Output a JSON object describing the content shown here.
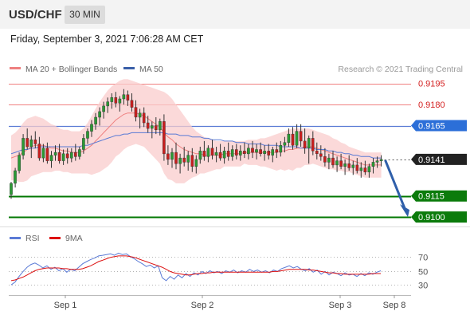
{
  "header": {
    "symbol": "USD/CHF",
    "timeframe": "30 MIN"
  },
  "timestamp": "Friday, September 3, 2021 7:06:28 AM CET",
  "legend": {
    "ma20_label": "MA 20 + Bollinger Bands",
    "ma50_label": "MA 50",
    "copyright": "Research © 2021 Trading Central"
  },
  "colors": {
    "bull": "#2a9a34",
    "bear": "#c81e1e",
    "ma20": "#ee8080",
    "ma50": "#5a7bd5",
    "band": "#f9cccc",
    "support": "#007700",
    "resistance": "#f08080",
    "current": "#222222",
    "arrow": "#2f5faa",
    "rsi": "#5b7bd6",
    "rsi_ma": "#dd1111"
  },
  "chart_data": [
    {
      "type": "candlestick",
      "ylim": [
        0.9095,
        0.9205
      ],
      "x_ticks": [
        "Sep 1",
        "Sep 2",
        "Sep 3",
        "Sep 8"
      ],
      "levels": [
        {
          "label": "0.9195",
          "value": 0.9195,
          "kind": "resistance"
        },
        {
          "label": "0.9180",
          "value": 0.918,
          "kind": "resistance"
        },
        {
          "label": "0.9165",
          "value": 0.9165,
          "kind": "pivot"
        },
        {
          "label": "0.9141",
          "value": 0.9141,
          "kind": "current"
        },
        {
          "label": "0.9115",
          "value": 0.9115,
          "kind": "support"
        },
        {
          "label": "0.9100",
          "value": 0.91,
          "kind": "support"
        }
      ],
      "forecast_arrow": {
        "from": 0.9141,
        "to": 0.91
      },
      "candles": [
        [
          0.9116,
          0.9125,
          0.9113,
          0.9124
        ],
        [
          0.9124,
          0.9135,
          0.9121,
          0.9133
        ],
        [
          0.9133,
          0.9146,
          0.9131,
          0.9144
        ],
        [
          0.9144,
          0.9159,
          0.9141,
          0.9156
        ],
        [
          0.9156,
          0.9163,
          0.9148,
          0.915
        ],
        [
          0.915,
          0.9158,
          0.9142,
          0.9155
        ],
        [
          0.9155,
          0.9161,
          0.9149,
          0.9152
        ],
        [
          0.9152,
          0.9157,
          0.914,
          0.9142
        ],
        [
          0.9142,
          0.9152,
          0.9139,
          0.9149
        ],
        [
          0.9149,
          0.9153,
          0.9138,
          0.914
        ],
        [
          0.914,
          0.9147,
          0.9135,
          0.9144
        ],
        [
          0.9144,
          0.9151,
          0.914,
          0.9146
        ],
        [
          0.9146,
          0.9152,
          0.9138,
          0.914
        ],
        [
          0.914,
          0.9148,
          0.9137,
          0.9145
        ],
        [
          0.9145,
          0.9149,
          0.9138,
          0.9142
        ],
        [
          0.9142,
          0.9149,
          0.9139,
          0.9146
        ],
        [
          0.9146,
          0.9152,
          0.914,
          0.9143
        ],
        [
          0.9143,
          0.915,
          0.9141,
          0.9148
        ],
        [
          0.9148,
          0.9159,
          0.9145,
          0.9156
        ],
        [
          0.9156,
          0.9163,
          0.9152,
          0.9161
        ],
        [
          0.9161,
          0.9169,
          0.9157,
          0.9166
        ],
        [
          0.9166,
          0.9174,
          0.9162,
          0.9171
        ],
        [
          0.9171,
          0.9178,
          0.9165,
          0.9175
        ],
        [
          0.9175,
          0.9182,
          0.917,
          0.9179
        ],
        [
          0.9179,
          0.9185,
          0.9174,
          0.9182
        ],
        [
          0.9182,
          0.9188,
          0.9177,
          0.9185
        ],
        [
          0.9185,
          0.9189,
          0.9178,
          0.9181
        ],
        [
          0.9181,
          0.9186,
          0.9175,
          0.9184
        ],
        [
          0.9184,
          0.9191,
          0.918,
          0.9187
        ],
        [
          0.9187,
          0.919,
          0.9179,
          0.9183
        ],
        [
          0.9183,
          0.9188,
          0.9175,
          0.9178
        ],
        [
          0.9178,
          0.9183,
          0.9168,
          0.9171
        ],
        [
          0.9171,
          0.9177,
          0.9163,
          0.9174
        ],
        [
          0.9174,
          0.9178,
          0.9164,
          0.9167
        ],
        [
          0.9167,
          0.9172,
          0.916,
          0.9163
        ],
        [
          0.9163,
          0.9168,
          0.9156,
          0.9165
        ],
        [
          0.9165,
          0.9171,
          0.9159,
          0.9162
        ],
        [
          0.9162,
          0.917,
          0.9158,
          0.9168
        ],
        [
          0.9168,
          0.9173,
          0.914,
          0.9145
        ],
        [
          0.9145,
          0.9151,
          0.9137,
          0.9141
        ],
        [
          0.9141,
          0.9149,
          0.9135,
          0.9146
        ],
        [
          0.9146,
          0.9153,
          0.9134,
          0.9138
        ],
        [
          0.9138,
          0.9145,
          0.9131,
          0.9142
        ],
        [
          0.9142,
          0.915,
          0.9136,
          0.9139
        ],
        [
          0.9139,
          0.9147,
          0.9133,
          0.9144
        ],
        [
          0.9144,
          0.9149,
          0.9132,
          0.9136
        ],
        [
          0.9136,
          0.9144,
          0.9131,
          0.9141
        ],
        [
          0.9141,
          0.915,
          0.9138,
          0.9147
        ],
        [
          0.9147,
          0.9154,
          0.914,
          0.9143
        ],
        [
          0.9143,
          0.9151,
          0.9139,
          0.9149
        ],
        [
          0.9149,
          0.9155,
          0.9141,
          0.9144
        ],
        [
          0.9144,
          0.915,
          0.9139,
          0.9146
        ],
        [
          0.9146,
          0.9152,
          0.914,
          0.9142
        ],
        [
          0.9142,
          0.915,
          0.9138,
          0.9147
        ],
        [
          0.9147,
          0.9153,
          0.914,
          0.9143
        ],
        [
          0.9143,
          0.9151,
          0.914,
          0.9148
        ],
        [
          0.9148,
          0.9152,
          0.9141,
          0.9144
        ],
        [
          0.9144,
          0.9151,
          0.914,
          0.9147
        ],
        [
          0.9147,
          0.9153,
          0.9142,
          0.9145
        ],
        [
          0.9145,
          0.9152,
          0.9141,
          0.9149
        ],
        [
          0.9149,
          0.9154,
          0.9142,
          0.9146
        ],
        [
          0.9146,
          0.9152,
          0.9141,
          0.9148
        ],
        [
          0.9148,
          0.9153,
          0.9143,
          0.9145
        ],
        [
          0.9145,
          0.9151,
          0.914,
          0.9147
        ],
        [
          0.9147,
          0.9152,
          0.9141,
          0.9144
        ],
        [
          0.9144,
          0.915,
          0.9139,
          0.9148
        ],
        [
          0.9148,
          0.9153,
          0.9142,
          0.9146
        ],
        [
          0.9146,
          0.9154,
          0.9143,
          0.9151
        ],
        [
          0.9151,
          0.9157,
          0.9146,
          0.9153
        ],
        [
          0.9153,
          0.9163,
          0.915,
          0.9159
        ],
        [
          0.9159,
          0.9164,
          0.9148,
          0.9151
        ],
        [
          0.9151,
          0.9166,
          0.9149,
          0.9161
        ],
        [
          0.9161,
          0.9166,
          0.915,
          0.9154
        ],
        [
          0.9154,
          0.9163,
          0.9145,
          0.9149
        ],
        [
          0.9149,
          0.9158,
          0.9138,
          0.9156
        ],
        [
          0.9156,
          0.9161,
          0.9144,
          0.9147
        ],
        [
          0.9147,
          0.9153,
          0.9141,
          0.9145
        ],
        [
          0.9145,
          0.9151,
          0.914,
          0.9143
        ],
        [
          0.9143,
          0.9149,
          0.9136,
          0.9139
        ],
        [
          0.9139,
          0.9145,
          0.9134,
          0.9142
        ],
        [
          0.9142,
          0.9147,
          0.9135,
          0.9137
        ],
        [
          0.9137,
          0.9143,
          0.9132,
          0.914
        ],
        [
          0.914,
          0.9145,
          0.9134,
          0.9136
        ],
        [
          0.9136,
          0.9141,
          0.913,
          0.9138
        ],
        [
          0.9138,
          0.9144,
          0.9133,
          0.9135
        ],
        [
          0.9135,
          0.914,
          0.913,
          0.9137
        ],
        [
          0.9137,
          0.9142,
          0.9131,
          0.9133
        ],
        [
          0.9133,
          0.9139,
          0.9128,
          0.9135
        ],
        [
          0.9135,
          0.914,
          0.913,
          0.9132
        ],
        [
          0.9132,
          0.9138,
          0.9128,
          0.9136
        ],
        [
          0.9136,
          0.9142,
          0.9131,
          0.9139
        ],
        [
          0.9139,
          0.9143,
          0.9135,
          0.914
        ],
        [
          0.914,
          0.9144,
          0.9136,
          0.9141
        ]
      ],
      "ma20": [
        0.9142,
        0.9143,
        0.9144,
        0.9146,
        0.9148,
        0.915,
        0.9151,
        0.9151,
        0.9151,
        0.915,
        0.9149,
        0.9149,
        0.9148,
        0.9147,
        0.9147,
        0.9146,
        0.9146,
        0.9146,
        0.9147,
        0.9149,
        0.9151,
        0.9154,
        0.9157,
        0.916,
        0.9163,
        0.9166,
        0.9169,
        0.9171,
        0.9173,
        0.9174,
        0.9174,
        0.9174,
        0.9173,
        0.9172,
        0.917,
        0.9168,
        0.9166,
        0.9164,
        0.916,
        0.9157,
        0.9155,
        0.9152,
        0.915,
        0.9148,
        0.9147,
        0.9146,
        0.9145,
        0.9145,
        0.9144,
        0.9144,
        0.9144,
        0.9144,
        0.9144,
        0.9145,
        0.9145,
        0.9145,
        0.9145,
        0.9145,
        0.9146,
        0.9146,
        0.9146,
        0.9146,
        0.9146,
        0.9146,
        0.9146,
        0.9146,
        0.9146,
        0.9147,
        0.9147,
        0.9148,
        0.9148,
        0.9149,
        0.9149,
        0.915,
        0.915,
        0.915,
        0.9149,
        0.9148,
        0.9147,
        0.9146,
        0.9145,
        0.9144,
        0.9143,
        0.9142,
        0.9141,
        0.914,
        0.9139,
        0.9138,
        0.9137,
        0.9137,
        0.9137,
        0.9137,
        0.9137
      ],
      "ma50": [
        0.9145,
        0.9146,
        0.9147,
        0.9148,
        0.9148,
        0.9149,
        0.9149,
        0.915,
        0.915,
        0.915,
        0.915,
        0.915,
        0.915,
        0.915,
        0.915,
        0.915,
        0.915,
        0.915,
        0.9151,
        0.9151,
        0.9152,
        0.9153,
        0.9154,
        0.9155,
        0.9156,
        0.9157,
        0.9158,
        0.9158,
        0.9159,
        0.9159,
        0.916,
        0.916,
        0.916,
        0.916,
        0.916,
        0.916,
        0.916,
        0.916,
        0.916,
        0.9159,
        0.9159,
        0.9159,
        0.9158,
        0.9158,
        0.9158,
        0.9157,
        0.9157,
        0.9157,
        0.9156,
        0.9156,
        0.9155,
        0.9155,
        0.9155,
        0.9154,
        0.9154,
        0.9154,
        0.9153,
        0.9153,
        0.9153,
        0.9152,
        0.9152,
        0.9152,
        0.9152,
        0.9151,
        0.9151,
        0.9151,
        0.9151,
        0.915,
        0.915,
        0.915,
        0.915,
        0.915,
        0.9149,
        0.9149,
        0.9149,
        0.9149,
        0.9148,
        0.9148,
        0.9148,
        0.9147,
        0.9147,
        0.9146,
        0.9146,
        0.9145,
        0.9145,
        0.9144,
        0.9144,
        0.9143,
        0.9143,
        0.9143,
        0.9142,
        0.9142,
        0.9142
      ],
      "band_upper": [
        0.9158,
        0.916,
        0.9163,
        0.9167,
        0.917,
        0.9171,
        0.9172,
        0.9171,
        0.917,
        0.9168,
        0.9166,
        0.9165,
        0.9163,
        0.9162,
        0.9162,
        0.9161,
        0.9161,
        0.9161,
        0.9163,
        0.9167,
        0.9172,
        0.9177,
        0.9182,
        0.9186,
        0.919,
        0.9193,
        0.9195,
        0.9197,
        0.9198,
        0.9198,
        0.9197,
        0.9196,
        0.9195,
        0.9194,
        0.9193,
        0.9192,
        0.9191,
        0.919,
        0.9189,
        0.9187,
        0.9184,
        0.918,
        0.9176,
        0.9172,
        0.9168,
        0.9164,
        0.9161,
        0.9159,
        0.9157,
        0.9156,
        0.9155,
        0.9154,
        0.9154,
        0.9154,
        0.9154,
        0.9154,
        0.9154,
        0.9154,
        0.9154,
        0.9155,
        0.9155,
        0.9155,
        0.9156,
        0.9156,
        0.9157,
        0.9158,
        0.9159,
        0.916,
        0.9161,
        0.9162,
        0.9163,
        0.9163,
        0.9163,
        0.9163,
        0.9163,
        0.9162,
        0.9161,
        0.916,
        0.9159,
        0.9158,
        0.9156,
        0.9155,
        0.9153,
        0.9152,
        0.915,
        0.9149,
        0.9148,
        0.9147,
        0.9146,
        0.9146,
        0.9146,
        0.9146,
        0.9146
      ],
      "band_lower": [
        0.9126,
        0.9126,
        0.9125,
        0.9125,
        0.9126,
        0.9129,
        0.913,
        0.9131,
        0.9132,
        0.9132,
        0.9132,
        0.9133,
        0.9133,
        0.9132,
        0.9132,
        0.9131,
        0.9131,
        0.9131,
        0.9131,
        0.9131,
        0.913,
        0.9131,
        0.9132,
        0.9134,
        0.9136,
        0.9139,
        0.9143,
        0.9145,
        0.9148,
        0.915,
        0.9151,
        0.9152,
        0.9151,
        0.915,
        0.9147,
        0.9144,
        0.9141,
        0.9138,
        0.9131,
        0.9127,
        0.9126,
        0.9124,
        0.9124,
        0.9124,
        0.9126,
        0.9128,
        0.9129,
        0.9131,
        0.9131,
        0.9132,
        0.9133,
        0.9134,
        0.9134,
        0.9136,
        0.9136,
        0.9136,
        0.9136,
        0.9136,
        0.9138,
        0.9137,
        0.9137,
        0.9137,
        0.9136,
        0.9136,
        0.9135,
        0.9134,
        0.9133,
        0.9134,
        0.9133,
        0.9134,
        0.9133,
        0.9135,
        0.9135,
        0.9137,
        0.9137,
        0.9138,
        0.9137,
        0.9136,
        0.9135,
        0.9134,
        0.9134,
        0.9133,
        0.9133,
        0.9132,
        0.9132,
        0.9131,
        0.913,
        0.9129,
        0.9128,
        0.9128,
        0.9128,
        0.9128,
        0.9128
      ]
    },
    {
      "type": "line",
      "legend": [
        "RSI",
        "9MA"
      ],
      "ylim": [
        20,
        80
      ],
      "y_ticks": [
        70,
        50,
        30
      ],
      "series": [
        {
          "name": "RSI",
          "values": [
            30,
            34,
            42,
            49,
            55,
            59,
            61,
            58,
            54,
            57,
            52,
            55,
            50,
            53,
            48,
            52,
            50,
            55,
            60,
            63,
            66,
            68,
            71,
            72,
            73,
            74,
            72,
            75,
            73,
            74,
            70,
            67,
            63,
            60,
            56,
            58,
            54,
            57,
            40,
            36,
            42,
            38,
            44,
            40,
            46,
            42,
            47,
            44,
            49,
            46,
            50,
            47,
            49,
            46,
            50,
            48,
            51,
            47,
            50,
            48,
            52,
            49,
            51,
            48,
            50,
            47,
            51,
            49,
            53,
            55,
            57,
            54,
            56,
            52,
            50,
            53,
            48,
            51,
            45,
            49,
            44,
            48,
            46,
            43,
            47,
            44,
            45,
            42,
            46,
            43,
            47,
            45,
            48,
            50
          ]
        },
        {
          "name": "9MA",
          "values": [
            36,
            37,
            39,
            41,
            44,
            47,
            50,
            52,
            53,
            54,
            54,
            54,
            54,
            53,
            53,
            52,
            52,
            52,
            53,
            55,
            57,
            60,
            63,
            65,
            67,
            69,
            70,
            71,
            71,
            71,
            70,
            69,
            67,
            65,
            63,
            61,
            59,
            57,
            55,
            52,
            49,
            47,
            46,
            45,
            44,
            44,
            45,
            46,
            46,
            47,
            47,
            48,
            48,
            48,
            48,
            48,
            48,
            48,
            48,
            48,
            48,
            48,
            48,
            48,
            48,
            48,
            49,
            49,
            50,
            51,
            52,
            52,
            52,
            52,
            52,
            51,
            51,
            50,
            49,
            48,
            47,
            47,
            46,
            46,
            45,
            45,
            45,
            45,
            45,
            45,
            45,
            46,
            46,
            46
          ]
        }
      ]
    }
  ]
}
